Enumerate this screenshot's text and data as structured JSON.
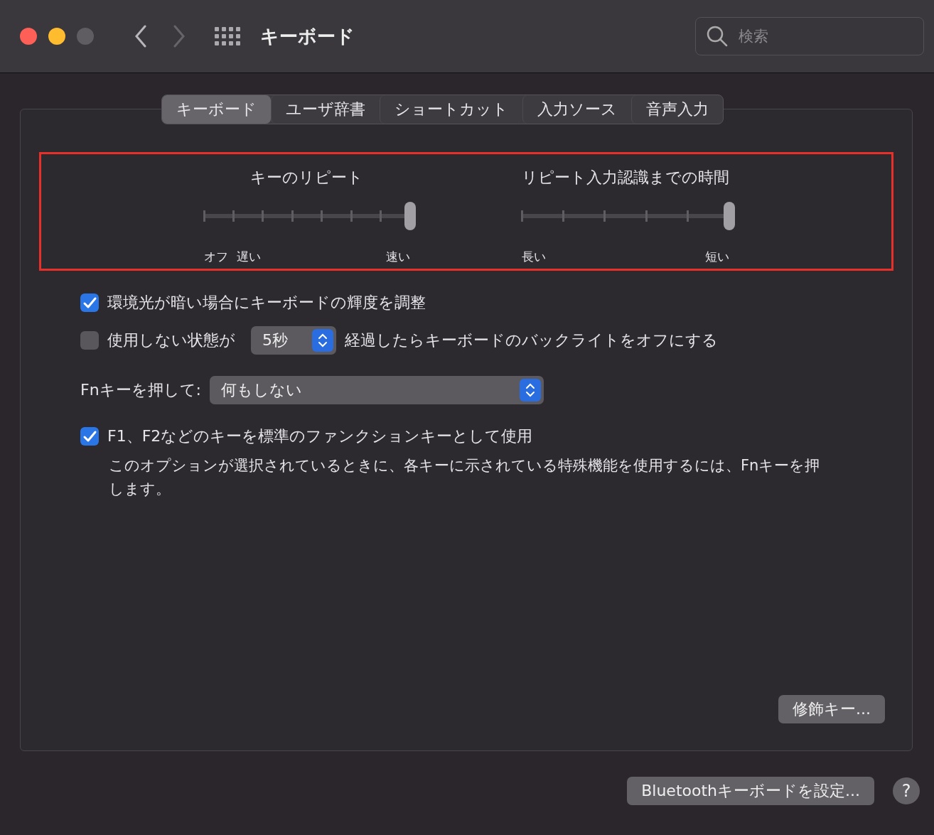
{
  "window": {
    "title": "キーボード",
    "search": {
      "placeholder": "検索"
    }
  },
  "tabs": [
    {
      "label": "キーボード",
      "selected": true
    },
    {
      "label": "ユーザ辞書",
      "selected": false
    },
    {
      "label": "ショートカット",
      "selected": false
    },
    {
      "label": "入力ソース",
      "selected": false
    },
    {
      "label": "音声入力",
      "selected": false
    }
  ],
  "sliders_highlighted": true,
  "sliders": [
    {
      "title": "キーのリピート",
      "level": 1,
      "left_labels": [
        "オフ",
        "遅い"
      ],
      "right_labels": [
        "速い"
      ]
    },
    {
      "title": "リピート入力認識までの時間",
      "level": 1,
      "left_labels": [
        "長い"
      ],
      "right_labels": [
        "短い"
      ]
    }
  ],
  "options": [
    {
      "kind": "checkbox",
      "checked": true,
      "label": "環境光が暗い場合にキーボードの輝度を調整"
    },
    {
      "kind": "checkbox-popup",
      "checked": false,
      "label": "使用しない状態が",
      "popup": "5秒",
      "after": "経過したらキーボードのバックライトをオフにする"
    },
    {
      "kind": "popup",
      "label": "Fnキーを押して:",
      "popup": "何もしない"
    },
    {
      "kind": "checkbox",
      "checked": true,
      "label": "F1、F2などのキーを標準のファンクションキーとして使用",
      "note": "このオプションが選択されているときに、各キーに示されている特殊機能を使用するには、Fnキーを押します。"
    }
  ],
  "modifier_button": "修飾キー...",
  "bluetooth_button": "Bluetoothキーボードを設定...",
  "help_button": "?"
}
